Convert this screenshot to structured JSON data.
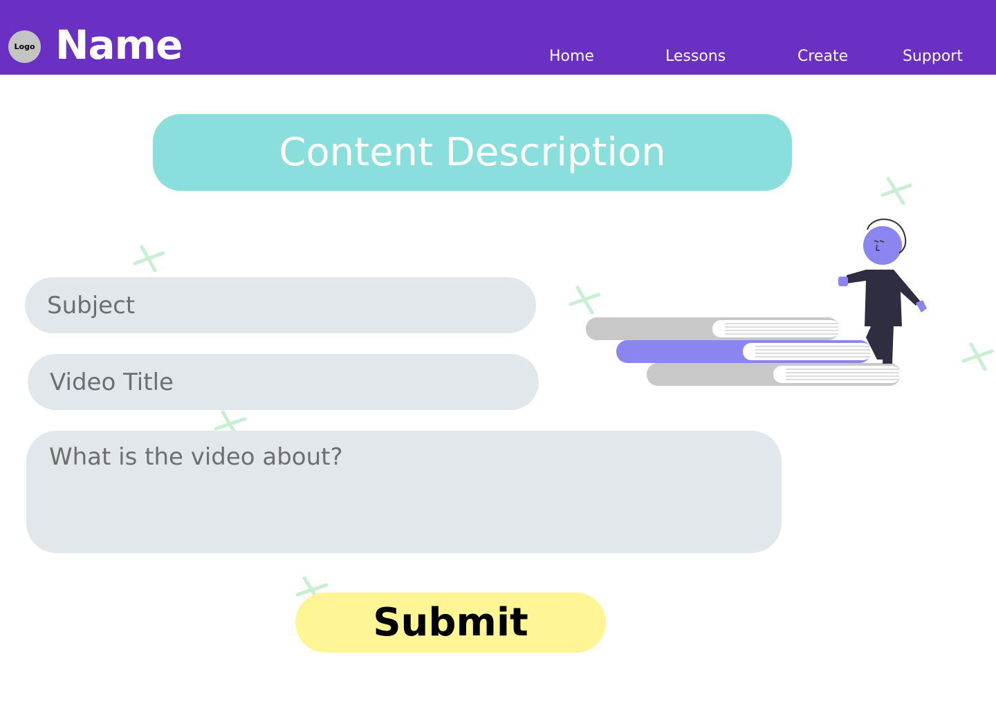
{
  "header": {
    "logo_label": "Logo",
    "brand_name": "Name",
    "nav": [
      {
        "label": "Home"
      },
      {
        "label": "Lessons"
      },
      {
        "label": "Create"
      },
      {
        "label": "Support"
      }
    ]
  },
  "main": {
    "title": "Content Description",
    "form": {
      "subject_placeholder": "Subject",
      "video_title_placeholder": "Video Title",
      "about_placeholder": "What is the video about?",
      "submit_label": "Submit"
    }
  },
  "colors": {
    "header_bg": "#6930c3",
    "title_bg": "#8adfdd",
    "field_bg": "#e1e7ea",
    "submit_bg": "#fff595",
    "accent_purple": "#8b85f0",
    "plus_green": "#c9efd3"
  },
  "icons": {
    "decor": "plus-icon",
    "illustration": "person-on-books-illustration"
  }
}
